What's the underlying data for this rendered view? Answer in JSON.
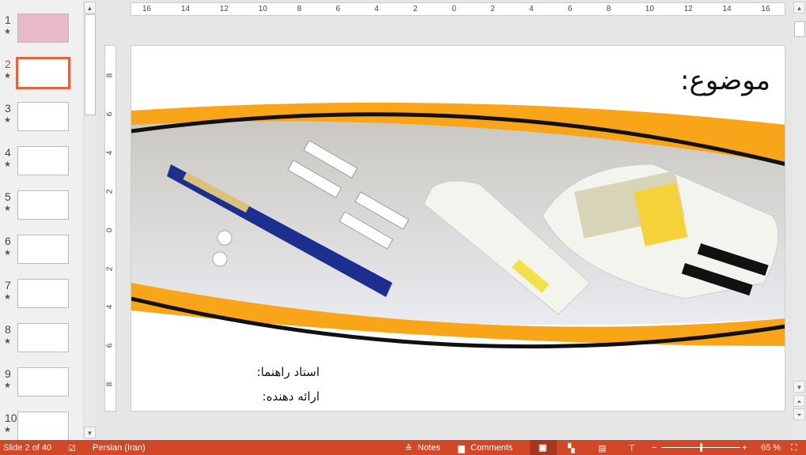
{
  "thumbnails": [
    {
      "num": "1",
      "color": "#e8b9c6"
    },
    {
      "num": "2",
      "color": "#fff"
    },
    {
      "num": "3",
      "color": "#fff"
    },
    {
      "num": "4",
      "color": "#fff"
    },
    {
      "num": "5",
      "color": "#fff"
    },
    {
      "num": "6",
      "color": "#fff"
    },
    {
      "num": "7",
      "color": "#fff"
    },
    {
      "num": "8",
      "color": "#fff"
    },
    {
      "num": "9",
      "color": "#fff"
    },
    {
      "num": "10",
      "color": "#fff"
    }
  ],
  "selected_slide": 2,
  "ruler": {
    "h": [
      "16",
      "14",
      "12",
      "10",
      "8",
      "6",
      "4",
      "2",
      "0",
      "2",
      "4",
      "6",
      "8",
      "10",
      "12",
      "14",
      "16"
    ],
    "v": [
      "8",
      "6",
      "4",
      "2",
      "0",
      "2",
      "4",
      "6",
      "8"
    ]
  },
  "slide": {
    "title": "موضوع:",
    "advisor": "استاد راهنما:",
    "presenter": "ارائه دهنده:"
  },
  "status": {
    "slide_info": "Slide 2 of 40",
    "language": "Persian (Iran)",
    "notes": "Notes",
    "comments": "Comments",
    "zoom": "65 %",
    "zoom_fraction": 0.5,
    "accent": "#d24726"
  }
}
